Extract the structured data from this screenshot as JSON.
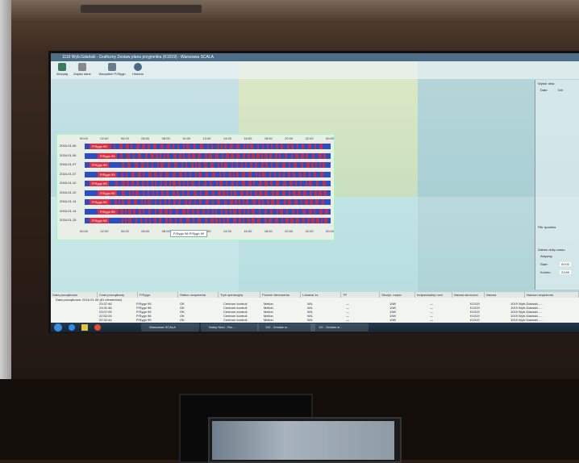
{
  "window": {
    "title": "1110 Wyb.Gdański - Graficzny Zestaw planu przyjmnika (K1019) - Warszawa SCALA"
  },
  "toolbar": {
    "buttons": [
      "Wczytaj",
      "Zapisz dane",
      "Wszystkie P/Stygn",
      "Historia"
    ]
  },
  "gantt": {
    "time_ticks": [
      "00:00",
      "02:00",
      "04:00",
      "06:00",
      "08:00",
      "10:00",
      "12:00",
      "14:00",
      "16:00",
      "18:00",
      "20:00",
      "22:00",
      "00:00"
    ],
    "dates": [
      "2016-01-06",
      "2016-01-06",
      "2016-01-07",
      "2016-01-07",
      "2016-01-10",
      "2016-01-10",
      "2016-01-14",
      "2016-01-14",
      "2016-01-15"
    ],
    "tag_label": "P/Sygn 99",
    "legend": "P/Sygn 98   P/Sygn 99"
  },
  "sidebar": {
    "section_date": "Wybór dnia",
    "col_date": "Data",
    "col_day": "Dni",
    "section_filter": "Filtr tyczdów",
    "section_range": "Zakres doby czasu",
    "active": "Aktywny",
    "start_label": "Start:",
    "end_label": "Koniec:",
    "start_val": "00:00",
    "end_val": "23:59"
  },
  "table": {
    "headers": [
      "Data początkowa",
      "Czas początkowy",
      "P/Sygn.",
      "Status urządzenia",
      "Tryb operacyjny",
      "Poziom sterowania",
      "Lokalna 1s",
      "TP",
      "Skrzyż. część.",
      "Indywidualny ruch",
      "Nazwa skrócona",
      "Nazwa",
      "Nazwa urządzenia"
    ],
    "group": "Data początkowa: 2016-01-08 (81 elementów)",
    "rows": [
      {
        "time": "23:37:46",
        "sygn": "P/Sygn 99",
        "status": "OK",
        "tryb": "Centrum kontroli",
        "poziom": "Mellon",
        "lok": "W/L",
        "tp": "—",
        "skr": "1/W/",
        "ind": "—",
        "short": "K1019",
        "name": "1019 Wyb.Gdański -..."
      },
      {
        "time": "23:31:46",
        "sygn": "P/Sygn 98",
        "status": "OK",
        "tryb": "Centrum kontroli",
        "poziom": "Mellon",
        "lok": "W/L",
        "tp": "—",
        "skr": "1/W/",
        "ind": "—",
        "short": "K1019",
        "name": "1019 Wyb.Gdański -..."
      },
      {
        "time": "23:07:05",
        "sygn": "P/Sygn 99",
        "status": "OK",
        "tryb": "Centrum kontroli",
        "poziom": "Mellon",
        "lok": "W/L",
        "tp": "—",
        "skr": "1/W/",
        "ind": "—",
        "short": "K1019",
        "name": "1019 Wyb.Gdański -..."
      },
      {
        "time": "22:52:25",
        "sygn": "P/Sygn 98",
        "status": "OK",
        "tryb": "Centrum kontroli",
        "poziom": "Mellon",
        "lok": "W/L",
        "tp": "—",
        "skr": "1/W/",
        "ind": "—",
        "short": "K1019",
        "name": "1019 Wyb.Gdański -..."
      },
      {
        "time": "22:32:44",
        "sygn": "P/Sygn 99",
        "status": "OK",
        "tryb": "Centrum kontroli",
        "poziom": "Mellon",
        "lok": "W/L",
        "tp": "—",
        "skr": "1/W/",
        "ind": "—",
        "short": "K1019",
        "name": "1019 Wyb.Gdański -..."
      }
    ]
  },
  "taskbar": {
    "tasks": [
      "Warszawa SCALA",
      "Notep Mod - Rur...",
      "110 - Zestaw w...",
      "1/2 - Zestaw w..."
    ]
  },
  "colors": {
    "sygn98": "#2b4ec4",
    "sygn99": "#c0304d",
    "titlebar": "#4e6d86"
  }
}
